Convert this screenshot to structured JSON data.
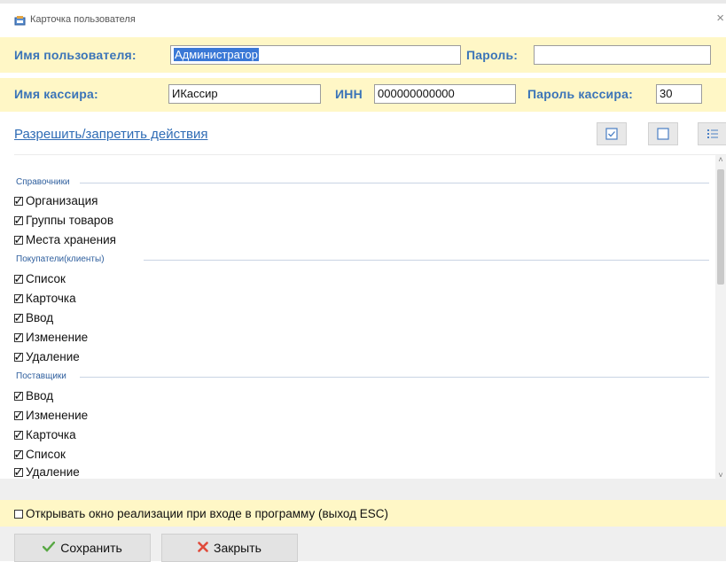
{
  "window": {
    "title": "Карточка пользователя",
    "close_glyph": "×"
  },
  "user": {
    "username_label": "Имя пользователя:",
    "username_value": "Администратор",
    "password_label": "Пароль:",
    "password_value": ""
  },
  "cashier": {
    "name_label": "Имя кассира:",
    "name_value": "ИКассир",
    "inn_label": "ИНН",
    "inn_value": "000000000000",
    "password_label": "Пароль кассира:",
    "password_value": "30"
  },
  "permissions": {
    "link_label": "Разрешить/запретить действия",
    "toolbar": {
      "check_all_icon": "checkbox-checked-icon",
      "uncheck_all_icon": "checkbox-empty-icon",
      "list_icon": "list-icon"
    },
    "groups": [
      {
        "title": "Справочники",
        "items": [
          {
            "label": "Организация",
            "checked": true
          },
          {
            "label": "Группы товаров",
            "checked": true
          },
          {
            "label": "Места хранения",
            "checked": true
          }
        ]
      },
      {
        "title": "Покупатели(клиенты)",
        "items": [
          {
            "label": "Список",
            "checked": true
          },
          {
            "label": "Карточка",
            "checked": true
          },
          {
            "label": "Ввод",
            "checked": true
          },
          {
            "label": "Изменение",
            "checked": true
          },
          {
            "label": "Удаление",
            "checked": true
          }
        ]
      },
      {
        "title": "Поставщики",
        "items": [
          {
            "label": "Ввод",
            "checked": true
          },
          {
            "label": "Изменение",
            "checked": true
          },
          {
            "label": "Карточка",
            "checked": true
          },
          {
            "label": "Список",
            "checked": true
          },
          {
            "label": "Удаление",
            "checked": true
          }
        ]
      }
    ]
  },
  "open_sales_option": {
    "label": "Открывать окно реализации при входе в программу (выход ESC)",
    "checked": false
  },
  "footer": {
    "save_label": "Сохранить",
    "close_label": "Закрыть"
  },
  "colors": {
    "label_blue": "#3a74b8",
    "link_blue": "#2f6cb5",
    "row_yellow": "#fff7c6",
    "selection_blue": "#3a78d6"
  }
}
